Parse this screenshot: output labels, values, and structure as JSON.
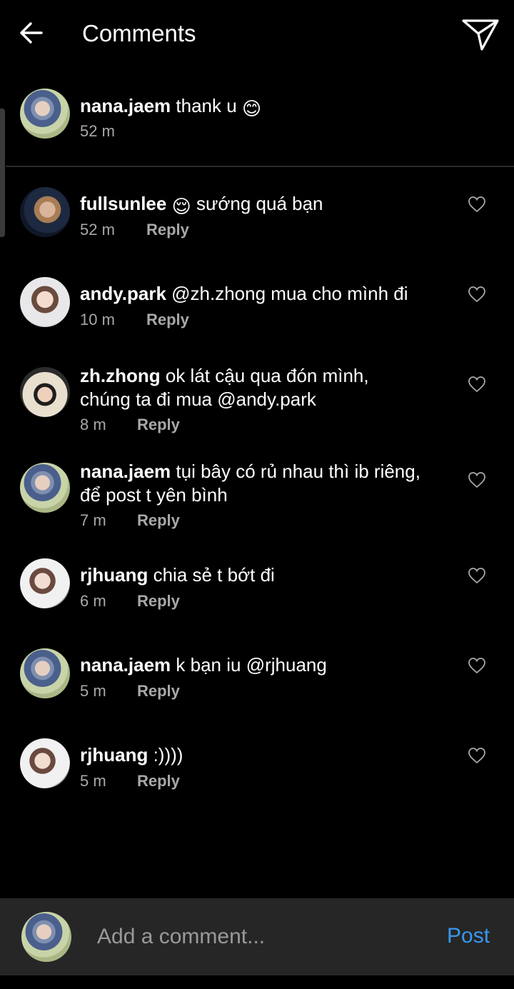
{
  "header": {
    "title": "Comments",
    "back_icon": "arrow-left-icon",
    "send_icon": "paper-plane-icon"
  },
  "caption": {
    "username": "nana.jaem",
    "text": "thank u",
    "emoji": "😊",
    "time": "52 m"
  },
  "comments": [
    {
      "username": "fullsunlee",
      "emoji": "😌",
      "text": "sướng quá bạn",
      "time": "52 m",
      "reply_label": "Reply"
    },
    {
      "username": "andy.park",
      "text": "@zh.zhong mua cho mình đi",
      "time": "10 m",
      "reply_label": "Reply"
    },
    {
      "username": "zh.zhong",
      "text": "ok lát cậu qua đón mình,",
      "text2": "chúng ta đi mua @andy.park",
      "time": "8 m",
      "reply_label": "Reply"
    },
    {
      "username": "nana.jaem",
      "text": "tụi bây có rủ nhau thì ib riêng,",
      "text2": "để post t yên bình",
      "time": "7 m",
      "reply_label": "Reply"
    },
    {
      "username": "rjhuang",
      "text": "chia sẻ t bớt đi",
      "time": "6 m",
      "reply_label": "Reply"
    },
    {
      "username": "nana.jaem",
      "text": "k bạn iu @rjhuang",
      "time": "5 m",
      "reply_label": "Reply"
    },
    {
      "username": "rjhuang",
      "text": ":))))",
      "time": "5 m",
      "reply_label": "Reply"
    }
  ],
  "composer": {
    "placeholder": "Add a comment...",
    "post_label": "Post"
  },
  "colors": {
    "background": "#000000",
    "composer_bg": "#262626",
    "post_link": "#3897f0",
    "meta_text": "#a8a8a8"
  }
}
